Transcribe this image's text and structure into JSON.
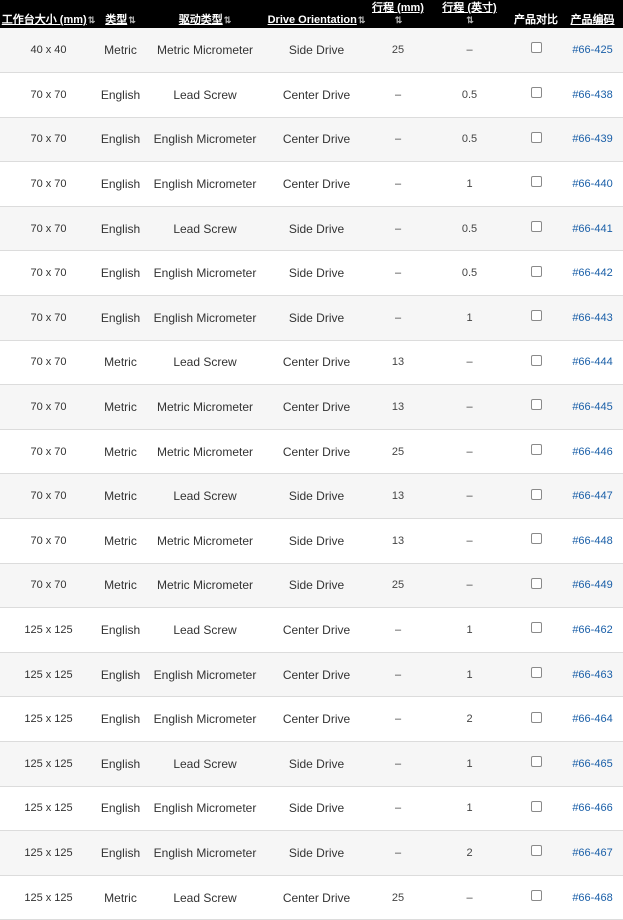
{
  "header": {
    "col_size": "工作台大小 (mm)",
    "col_type": "类型",
    "col_drive_type": "驱动类型",
    "col_orientation": "Drive Orientation",
    "col_travel_mm": "行程 (mm)",
    "col_travel_in": "行程 (英寸)",
    "col_compare": "产品对比",
    "col_code": "产品编码",
    "sort_glyph": "⇅"
  },
  "rows": [
    {
      "size": "40 x 40",
      "type": "Metric",
      "drive": "Metric Micrometer",
      "orientation": "Side Drive",
      "travel_mm": "25",
      "travel_in": "–",
      "code": "#66-425"
    },
    {
      "size": "70 x 70",
      "type": "English",
      "drive": "Lead Screw",
      "orientation": "Center Drive",
      "travel_mm": "–",
      "travel_in": "0.5",
      "code": "#66-438"
    },
    {
      "size": "70 x 70",
      "type": "English",
      "drive": "English Micrometer",
      "orientation": "Center Drive",
      "travel_mm": "–",
      "travel_in": "0.5",
      "code": "#66-439"
    },
    {
      "size": "70 x 70",
      "type": "English",
      "drive": "English Micrometer",
      "orientation": "Center Drive",
      "travel_mm": "–",
      "travel_in": "1",
      "code": "#66-440"
    },
    {
      "size": "70 x 70",
      "type": "English",
      "drive": "Lead Screw",
      "orientation": "Side Drive",
      "travel_mm": "–",
      "travel_in": "0.5",
      "code": "#66-441"
    },
    {
      "size": "70 x 70",
      "type": "English",
      "drive": "English Micrometer",
      "orientation": "Side Drive",
      "travel_mm": "–",
      "travel_in": "0.5",
      "code": "#66-442"
    },
    {
      "size": "70 x 70",
      "type": "English",
      "drive": "English Micrometer",
      "orientation": "Side Drive",
      "travel_mm": "–",
      "travel_in": "1",
      "code": "#66-443"
    },
    {
      "size": "70 x 70",
      "type": "Metric",
      "drive": "Lead Screw",
      "orientation": "Center Drive",
      "travel_mm": "13",
      "travel_in": "–",
      "code": "#66-444"
    },
    {
      "size": "70 x 70",
      "type": "Metric",
      "drive": "Metric Micrometer",
      "orientation": "Center Drive",
      "travel_mm": "13",
      "travel_in": "–",
      "code": "#66-445"
    },
    {
      "size": "70 x 70",
      "type": "Metric",
      "drive": "Metric Micrometer",
      "orientation": "Center Drive",
      "travel_mm": "25",
      "travel_in": "–",
      "code": "#66-446"
    },
    {
      "size": "70 x 70",
      "type": "Metric",
      "drive": "Lead Screw",
      "orientation": "Side Drive",
      "travel_mm": "13",
      "travel_in": "–",
      "code": "#66-447"
    },
    {
      "size": "70 x 70",
      "type": "Metric",
      "drive": "Metric Micrometer",
      "orientation": "Side Drive",
      "travel_mm": "13",
      "travel_in": "–",
      "code": "#66-448"
    },
    {
      "size": "70 x 70",
      "type": "Metric",
      "drive": "Metric Micrometer",
      "orientation": "Side Drive",
      "travel_mm": "25",
      "travel_in": "–",
      "code": "#66-449"
    },
    {
      "size": "125 x 125",
      "type": "English",
      "drive": "Lead Screw",
      "orientation": "Center Drive",
      "travel_mm": "–",
      "travel_in": "1",
      "code": "#66-462"
    },
    {
      "size": "125 x 125",
      "type": "English",
      "drive": "English Micrometer",
      "orientation": "Center Drive",
      "travel_mm": "–",
      "travel_in": "1",
      "code": "#66-463"
    },
    {
      "size": "125 x 125",
      "type": "English",
      "drive": "English Micrometer",
      "orientation": "Center Drive",
      "travel_mm": "–",
      "travel_in": "2",
      "code": "#66-464"
    },
    {
      "size": "125 x 125",
      "type": "English",
      "drive": "Lead Screw",
      "orientation": "Side Drive",
      "travel_mm": "–",
      "travel_in": "1",
      "code": "#66-465"
    },
    {
      "size": "125 x 125",
      "type": "English",
      "drive": "English Micrometer",
      "orientation": "Side Drive",
      "travel_mm": "–",
      "travel_in": "1",
      "code": "#66-466"
    },
    {
      "size": "125 x 125",
      "type": "English",
      "drive": "English Micrometer",
      "orientation": "Side Drive",
      "travel_mm": "–",
      "travel_in": "2",
      "code": "#66-467"
    },
    {
      "size": "125 x 125",
      "type": "Metric",
      "drive": "Lead Screw",
      "orientation": "Center Drive",
      "travel_mm": "25",
      "travel_in": "–",
      "code": "#66-468"
    }
  ]
}
